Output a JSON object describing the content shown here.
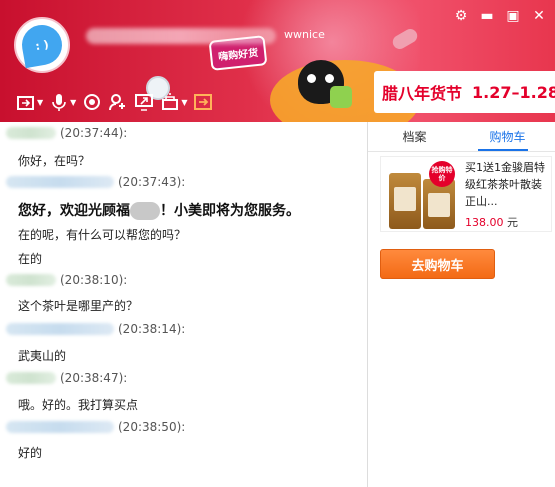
{
  "header": {
    "nickname_suffix": "wwnice",
    "banner_logo": "嗨购好货",
    "window_controls": [
      "⚙",
      "▬",
      "▣",
      "✕"
    ],
    "promo": {
      "title": "腊八年货节",
      "dates": "1.27–1.28"
    }
  },
  "toolbar": {
    "items": [
      {
        "name": "file-transfer-icon",
        "has_menu": true
      },
      {
        "name": "microphone-icon",
        "has_menu": true
      },
      {
        "name": "camera-icon",
        "has_menu": false
      },
      {
        "name": "add-contact-icon",
        "has_menu": false
      },
      {
        "name": "screen-share-icon",
        "has_menu": false
      },
      {
        "name": "remote-assist-icon",
        "has_menu": true
      },
      {
        "name": "forward-icon",
        "has_menu": false
      }
    ]
  },
  "chat": {
    "messages": [
      {
        "time": "(20:37:44):",
        "text": "你好，在吗？"
      },
      {
        "time": "(20:37:43):",
        "greeting_a": "您好，欢迎光顾福",
        "greeting_b": "！小美即将为您服务。",
        "text": "在的呢，有什么可以帮您的吗？",
        "text2": "在的"
      },
      {
        "time": "(20:38:10):",
        "text": "这个茶叶是哪里产的？"
      },
      {
        "time": "(20:38:14):",
        "text": "武夷山的"
      },
      {
        "time": "(20:38:47):",
        "text": "哦。好的。我打算买点"
      },
      {
        "time": "(20:38:50):",
        "text": "好的"
      }
    ]
  },
  "panel": {
    "tabs": [
      "档案",
      "购物车"
    ],
    "active_tab": "购物车",
    "product": {
      "badge": "抢购特价",
      "title": "买1送1金骏眉特级红茶茶叶散装正山...",
      "price": "138.00",
      "unit": "元"
    },
    "cart_button": "去购物车"
  },
  "colors": {
    "accent": "#1a73e8",
    "price": "#e4002b",
    "cart_button": "#f36a15"
  }
}
